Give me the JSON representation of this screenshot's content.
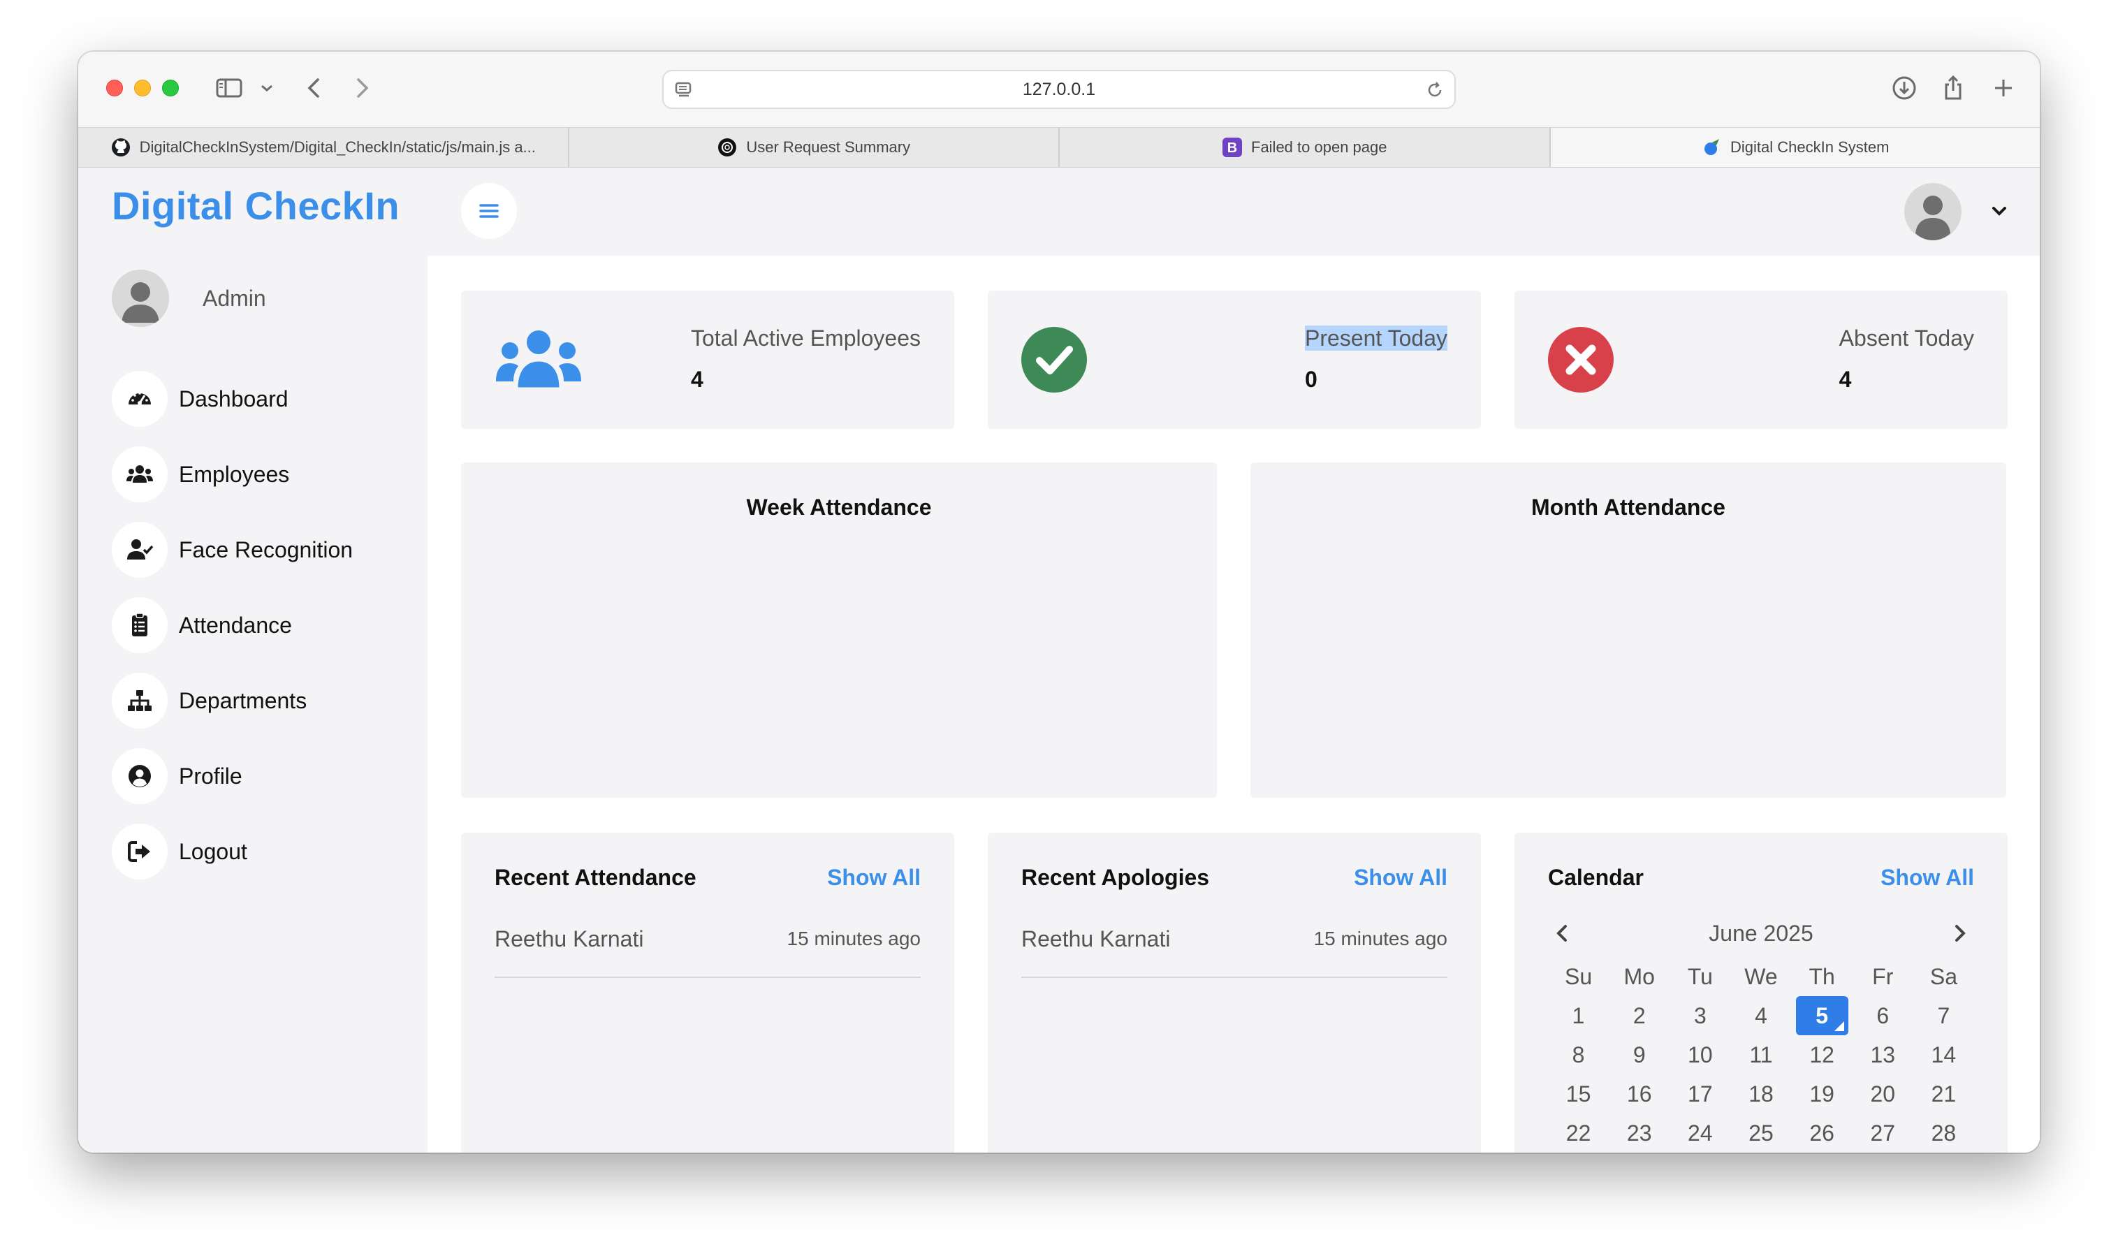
{
  "browser": {
    "url": "127.0.0.1",
    "tabs": [
      {
        "title": "DigitalCheckInSystem/Digital_CheckIn/static/js/main.js a...",
        "icon": "github-icon"
      },
      {
        "title": "User Request Summary",
        "icon": "openai-icon"
      },
      {
        "title": "Failed to open page",
        "icon": "bootstrap-icon"
      },
      {
        "title": "Digital CheckIn System",
        "icon": "app-icon"
      }
    ]
  },
  "brand": "Digital CheckIn",
  "user": {
    "name": "Admin"
  },
  "nav": [
    {
      "label": "Dashboard",
      "icon": "gauge-icon"
    },
    {
      "label": "Employees",
      "icon": "users-icon"
    },
    {
      "label": "Face Recognition",
      "icon": "user-check-icon"
    },
    {
      "label": "Attendance",
      "icon": "clipboard-icon"
    },
    {
      "label": "Departments",
      "icon": "sitemap-icon"
    },
    {
      "label": "Profile",
      "icon": "user-circle-icon"
    },
    {
      "label": "Logout",
      "icon": "sign-out-icon"
    }
  ],
  "stats": [
    {
      "label": "Total Active Employees",
      "value": "4",
      "icon": "users-icon",
      "color": "#3b8fe8"
    },
    {
      "label": "Present Today",
      "value": "0",
      "icon": "check-circle-icon",
      "color": "#3e8a57"
    },
    {
      "label": "Absent Today",
      "value": "4",
      "icon": "x-circle-icon",
      "color": "#d8404a"
    }
  ],
  "charts": [
    {
      "title": "Week Attendance"
    },
    {
      "title": "Month Attendance"
    }
  ],
  "recent_attendance": {
    "title": "Recent Attendance",
    "show_all": "Show All",
    "items": [
      {
        "name": "Reethu Karnati",
        "time": "15 minutes ago"
      }
    ]
  },
  "recent_apologies": {
    "title": "Recent Apologies",
    "show_all": "Show All",
    "items": [
      {
        "name": "Reethu Karnati",
        "time": "15 minutes ago"
      }
    ]
  },
  "calendar": {
    "title": "Calendar",
    "show_all": "Show All",
    "month": "June 2025",
    "weekdays": [
      "Su",
      "Mo",
      "Tu",
      "We",
      "Th",
      "Fr",
      "Sa"
    ],
    "days": [
      "1",
      "2",
      "3",
      "4",
      "5",
      "6",
      "7",
      "8",
      "9",
      "10",
      "11",
      "12",
      "13",
      "14",
      "15",
      "16",
      "17",
      "18",
      "19",
      "20",
      "21",
      "22",
      "23",
      "24",
      "25",
      "26",
      "27",
      "28"
    ],
    "selected": "5",
    "accent": "#2f7de6"
  },
  "colors": {
    "brand": "#3b8fe8",
    "link": "#3b8fe8"
  }
}
